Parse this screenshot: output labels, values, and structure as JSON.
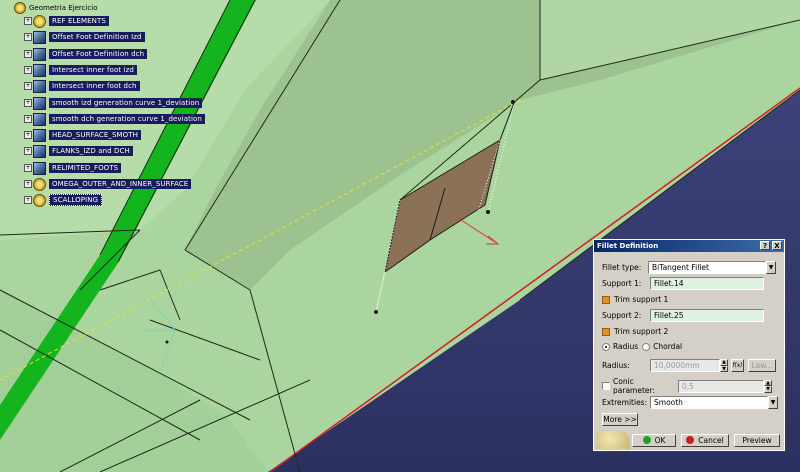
{
  "tree": {
    "root_label": "Geometria Ejercicio",
    "items": [
      {
        "label": "REF ELEMENTS",
        "icon": "gear-icon"
      },
      {
        "label": "Offset Foot Definition Izd",
        "icon": "surface-icon"
      },
      {
        "label": "Offset Foot Definition dch",
        "icon": "surface-icon"
      },
      {
        "label": "Intersect inner foot izd",
        "icon": "surface-icon"
      },
      {
        "label": "Intersect inner foot dch",
        "icon": "surface-icon"
      },
      {
        "label": "smooth izd generation curve 1_deviation",
        "icon": "surface-icon"
      },
      {
        "label": "smooth dch generation curve 1_deviation",
        "icon": "surface-icon"
      },
      {
        "label": "HEAD_SURFACE_SMOTH",
        "icon": "surface-icon"
      },
      {
        "label": "FLANKS_IZD and DCH",
        "icon": "surface-icon"
      },
      {
        "label": "RELIMITED_FOOTS",
        "icon": "surface-icon"
      },
      {
        "label": "OMEGA_OUTER_AND_INNER_SURFACE",
        "icon": "gear-icon"
      },
      {
        "label": "SCALLOPING",
        "icon": "gear-icon"
      }
    ]
  },
  "dialog": {
    "title": "Fillet Definition",
    "help_button": "?",
    "close_button": "X",
    "fillet_type_label": "Fillet type:",
    "fillet_type_value": "BiTangent Fillet",
    "support1_label": "Support 1:",
    "support1_value": "Fillet.14",
    "trim_support1_label": "Trim support 1",
    "support2_label": "Support 2:",
    "support2_value": "Fillet.25",
    "trim_support2_label": "Trim support 2",
    "radius_option_label": "Radius",
    "chordal_option_label": "Chordal",
    "radius_label": "Radius:",
    "radius_value": "10,0000mm",
    "fx_button": "f(x)",
    "law_button": "Law...",
    "conic_label": "Conic parameter:",
    "conic_value": "0,5",
    "extremities_label": "Extremities:",
    "extremities_value": "Smooth",
    "more_button": "More >>",
    "ok_button": "OK",
    "cancel_button": "Cancel",
    "preview_button": "Preview"
  },
  "colors": {
    "background": "#34386a",
    "surface": "#a9d59e",
    "green_strip": "#12b51c",
    "fillet_surface": "#8b7256",
    "tree_label_bg": "#171c5c",
    "dialog_title": "#0a246a",
    "ok_dot": "#1fa02a",
    "cancel_dot": "#c62020"
  }
}
